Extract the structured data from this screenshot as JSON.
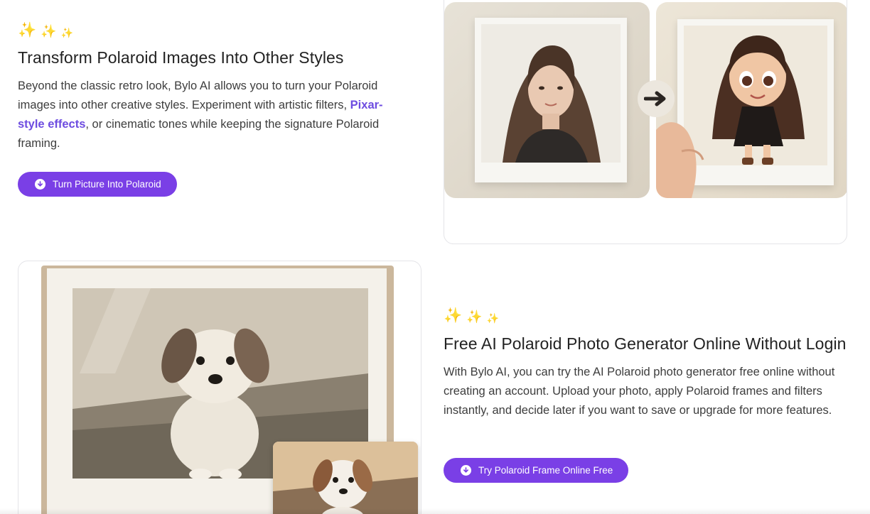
{
  "section1": {
    "sparkle_icon": "sparkles-icon",
    "title": "Transform Polaroid Images Into Other Styles",
    "text_before": "Beyond the classic retro look, Bylo AI allows you to turn your Polaroid images into other creative styles. Experiment with artistic filters, ",
    "link_text": "Pixar-style effects",
    "text_after": ", or cinematic tones while keeping the signature Polaroid framing.",
    "cta_label": "Turn Picture Into Polaroid",
    "cta_icon": "download-circle-icon"
  },
  "section2": {
    "sparkle_icon": "sparkles-icon",
    "title": "Free AI Polaroid Photo Generator Online Without Login",
    "text": "With Bylo AI, you can try the AI Polaroid photo generator free online without creating an account. Upload your photo, apply Polaroid frames and filters instantly, and decide later if you want to save or upgrade for more features.",
    "cta_label": "Try Polaroid Frame Online Free",
    "cta_icon": "download-circle-icon"
  },
  "colors": {
    "accent": "#7a3fe6",
    "link": "#6d4ce0",
    "sparkle": "#f5b82e"
  }
}
